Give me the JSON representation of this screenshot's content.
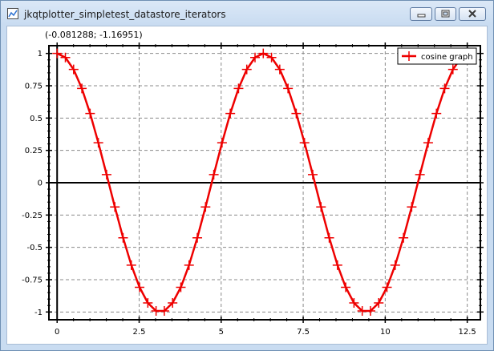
{
  "window": {
    "title": "jkqtplotter_simpletest_datastore_iterators",
    "icon": "plot-app-icon",
    "buttons": [
      "minimize-icon",
      "maximize-icon",
      "close-icon"
    ]
  },
  "coord_readout": "(-0.081288; -1.16951)",
  "colors": {
    "series": "#ee0000",
    "grid": "#8a8a8a",
    "axis": "#000000"
  },
  "chart_data": {
    "type": "line",
    "title": "",
    "xlabel": "",
    "ylabel": "",
    "xlim": [
      -0.25,
      12.9
    ],
    "ylim": [
      -1.06,
      1.06
    ],
    "x_ticks": [
      0,
      2.5,
      5,
      7.5,
      10,
      12.5
    ],
    "x_tick_labels": [
      "0",
      "2.5",
      "5",
      "7.5",
      "10",
      "12.5"
    ],
    "y_ticks": [
      1,
      0.75,
      0.5,
      0.25,
      0,
      -0.25,
      -0.5,
      -0.75,
      -1
    ],
    "y_tick_labels": [
      "1",
      "0.75",
      "0.5",
      "0.25",
      "0",
      "-0.25",
      "-0.5",
      "-0.75",
      "-1"
    ],
    "grid": true,
    "legend_position": "top-right",
    "series": [
      {
        "name": "cosine graph",
        "marker": "plus",
        "x": [
          0,
          0.2513,
          0.5027,
          0.754,
          1.0053,
          1.2566,
          1.508,
          1.7593,
          2.0106,
          2.2619,
          2.5133,
          2.7646,
          3.0159,
          3.2673,
          3.5186,
          3.7699,
          4.0212,
          4.2726,
          4.5239,
          4.7752,
          5.0265,
          5.2779,
          5.5292,
          5.7805,
          6.0319,
          6.2832,
          6.5345,
          6.7858,
          7.0372,
          7.2885,
          7.5398,
          7.7911,
          8.0425,
          8.2938,
          8.5451,
          8.7965,
          9.0478,
          9.2991,
          9.5504,
          9.8018,
          10.0531,
          10.3044,
          10.5558,
          10.8071,
          11.0584,
          11.3097,
          11.5611,
          11.8124,
          12.0637,
          12.315
        ],
        "y": [
          1,
          0.9686,
          0.8763,
          0.729,
          0.5358,
          0.309,
          0.0628,
          -0.1874,
          -0.4258,
          -0.6374,
          -0.809,
          -0.9298,
          -0.9921,
          -0.9921,
          -0.9298,
          -0.809,
          -0.6374,
          -0.4258,
          -0.1874,
          0.0628,
          0.309,
          0.5358,
          0.729,
          0.8763,
          0.9686,
          1,
          0.9686,
          0.8763,
          0.729,
          0.5358,
          0.309,
          0.0628,
          -0.1874,
          -0.4258,
          -0.6374,
          -0.809,
          -0.9298,
          -0.9921,
          -0.9921,
          -0.9298,
          -0.809,
          -0.6374,
          -0.4258,
          -0.1874,
          0.0628,
          0.309,
          0.5358,
          0.729,
          0.8763,
          0.9686
        ]
      }
    ]
  }
}
